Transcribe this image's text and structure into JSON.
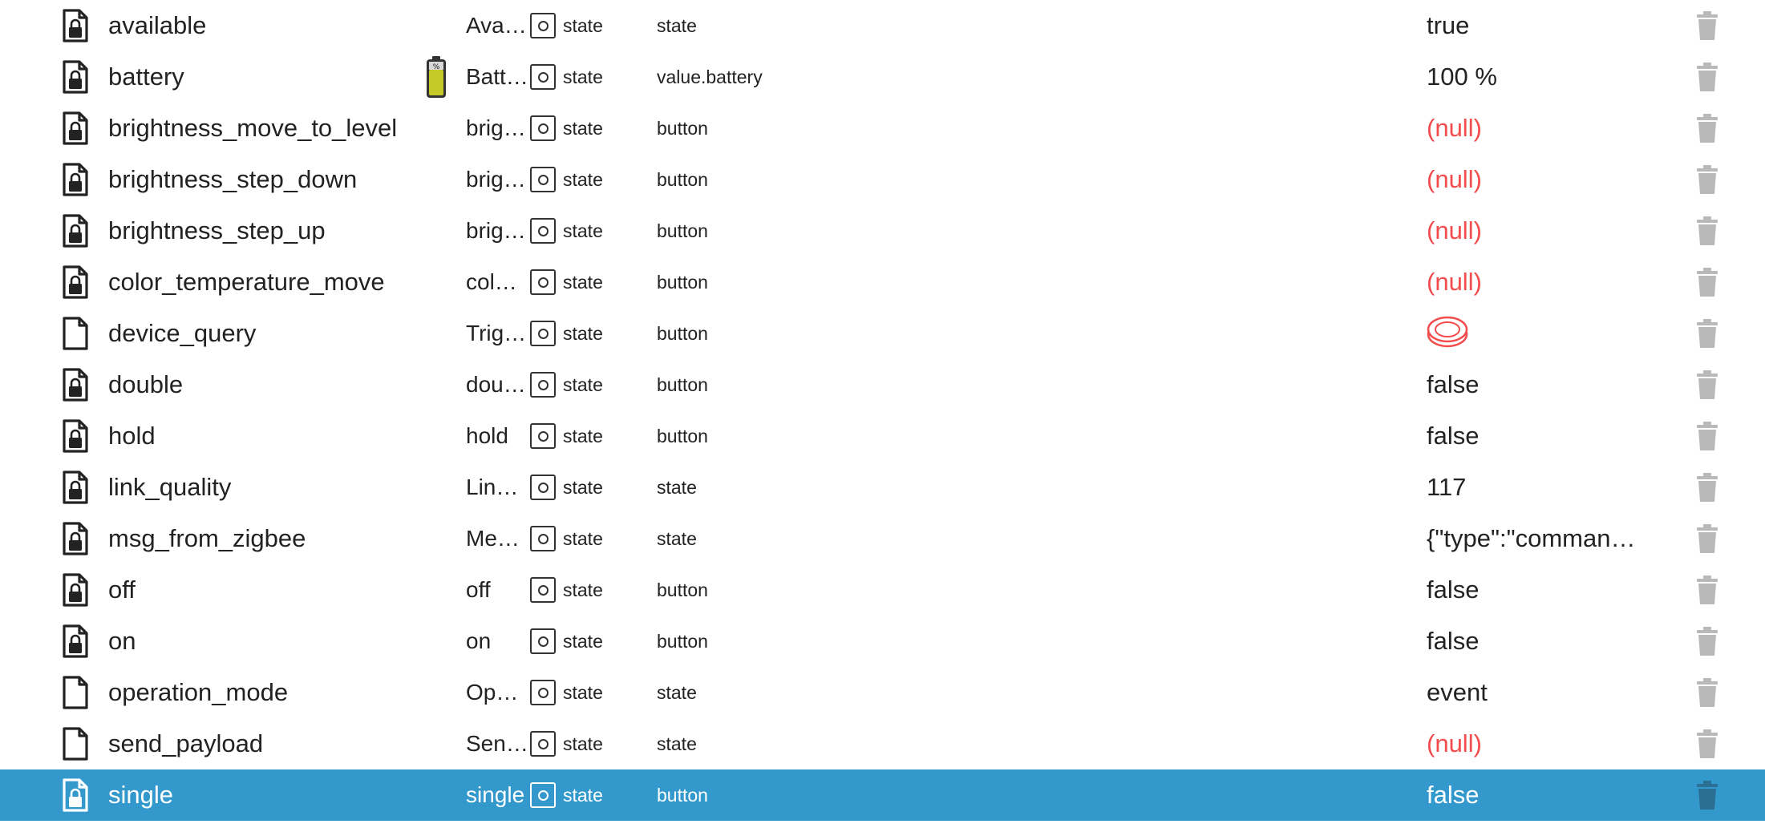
{
  "colors": {
    "selected_row_bg": "#3399cc",
    "null_value": "#f44c4c",
    "delete_icon": "#b9b9b9"
  },
  "rows": [
    {
      "name": "available",
      "desc": "Ava…",
      "type": "state",
      "role": "state",
      "value": "true",
      "value_kind": "text",
      "locked": true,
      "device_icon": "",
      "selected": false
    },
    {
      "name": "battery",
      "desc": "Batt…",
      "type": "state",
      "role": "value.battery",
      "value": "100 %",
      "value_kind": "text",
      "locked": true,
      "device_icon": "battery-icon",
      "selected": false
    },
    {
      "name": "brightness_move_to_level",
      "desc": "brig…",
      "type": "state",
      "role": "button",
      "value": "(null)",
      "value_kind": "null",
      "locked": true,
      "device_icon": "",
      "selected": false
    },
    {
      "name": "brightness_step_down",
      "desc": "brig…",
      "type": "state",
      "role": "button",
      "value": "(null)",
      "value_kind": "null",
      "locked": true,
      "device_icon": "",
      "selected": false
    },
    {
      "name": "brightness_step_up",
      "desc": "brig…",
      "type": "state",
      "role": "button",
      "value": "(null)",
      "value_kind": "null",
      "locked": true,
      "device_icon": "",
      "selected": false
    },
    {
      "name": "color_temperature_move",
      "desc": "col…",
      "type": "state",
      "role": "button",
      "value": "(null)",
      "value_kind": "null",
      "locked": true,
      "device_icon": "",
      "selected": false
    },
    {
      "name": "device_query",
      "desc": "Trig…",
      "type": "state",
      "role": "button",
      "value": "",
      "value_kind": "button",
      "locked": false,
      "device_icon": "",
      "selected": false
    },
    {
      "name": "double",
      "desc": "dou…",
      "type": "state",
      "role": "button",
      "value": "false",
      "value_kind": "text",
      "locked": true,
      "device_icon": "",
      "selected": false
    },
    {
      "name": "hold",
      "desc": "hold",
      "type": "state",
      "role": "button",
      "value": "false",
      "value_kind": "text",
      "locked": true,
      "device_icon": "",
      "selected": false
    },
    {
      "name": "link_quality",
      "desc": "Lin…",
      "type": "state",
      "role": "state",
      "value": "117",
      "value_kind": "text",
      "locked": true,
      "device_icon": "",
      "selected": false
    },
    {
      "name": "msg_from_zigbee",
      "desc": "Me…",
      "type": "state",
      "role": "state",
      "value": "{\"type\":\"comman…",
      "value_kind": "text",
      "locked": true,
      "device_icon": "",
      "selected": false
    },
    {
      "name": "off",
      "desc": "off",
      "type": "state",
      "role": "button",
      "value": "false",
      "value_kind": "text",
      "locked": true,
      "device_icon": "",
      "selected": false
    },
    {
      "name": "on",
      "desc": "on",
      "type": "state",
      "role": "button",
      "value": "false",
      "value_kind": "text",
      "locked": true,
      "device_icon": "",
      "selected": false
    },
    {
      "name": "operation_mode",
      "desc": "Op…",
      "type": "state",
      "role": "state",
      "value": "event",
      "value_kind": "text",
      "locked": false,
      "device_icon": "",
      "selected": false
    },
    {
      "name": "send_payload",
      "desc": "Sen…",
      "type": "state",
      "role": "state",
      "value": "(null)",
      "value_kind": "null",
      "locked": false,
      "device_icon": "",
      "selected": false
    },
    {
      "name": "single",
      "desc": "single",
      "type": "state",
      "role": "button",
      "value": "false",
      "value_kind": "text",
      "locked": true,
      "device_icon": "",
      "selected": true
    }
  ]
}
